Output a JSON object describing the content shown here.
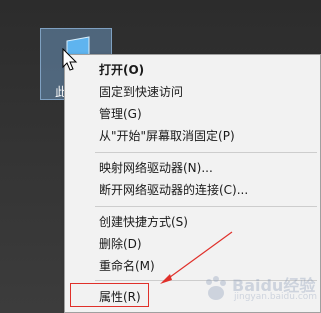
{
  "desktop": {
    "icon_label": "此"
  },
  "context_menu": {
    "items": [
      {
        "label": "打开(O)"
      },
      {
        "label": "固定到快速访问"
      },
      {
        "label": "管理(G)"
      },
      {
        "label": "从\"开始\"屏幕取消固定(P)"
      },
      {
        "label": "映射网络驱动器(N)..."
      },
      {
        "label": "断开网络驱动器的连接(C)..."
      },
      {
        "label": "创建快捷方式(S)"
      },
      {
        "label": "删除(D)"
      },
      {
        "label": "重命名(M)"
      },
      {
        "label": "属性(R)"
      }
    ]
  },
  "annotation": {
    "highlight_color": "#e0302a",
    "highlighted_item": "属性(R)"
  },
  "watermark": {
    "text": "Baidu经验",
    "sub": "jingyan.baidu.com"
  }
}
